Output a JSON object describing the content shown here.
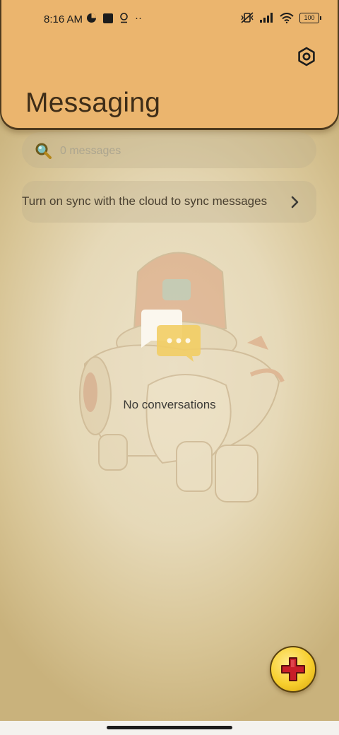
{
  "status_bar": {
    "time": "8:16 AM",
    "extra": "··",
    "battery": "100"
  },
  "header": {
    "title": "Messaging",
    "settings_icon": "gear-icon",
    "background_color": "#ebb56e"
  },
  "search": {
    "placeholder": "0 messages",
    "icon": "search-icon"
  },
  "sync_banner": {
    "text": "Turn on sync with the cloud to sync messages",
    "icon": "chevron-right-icon"
  },
  "empty_state": {
    "text": "No conversations",
    "icon": "chat-bubble-icon"
  },
  "fab": {
    "icon": "plus-icon",
    "color": "#f7cf2e",
    "plus_color": "#c81e28"
  }
}
